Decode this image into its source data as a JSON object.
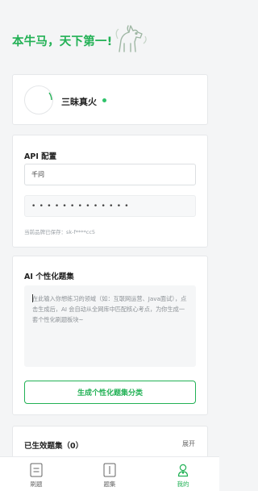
{
  "banner": {
    "slogan": "本牛马，天下第一!"
  },
  "profile": {
    "name": "三昧真火",
    "status_color": "#2fc26a"
  },
  "api_config": {
    "title": "API 配置",
    "model_value": "千问",
    "key_value": "•••••••••••••",
    "saved_hint": "当前品牌已保存：sk-f****cc5"
  },
  "ai_section": {
    "title": "AI 个性化题集",
    "placeholder": "在此输入你想练习的领域（如：互联网运营、Java面试），点击生成后，AI 会自动从全网库中匹配核心考点，为你生成一套个性化刷题板块~",
    "generate_label": "生成个性化题集分类"
  },
  "generated_section": {
    "title": "已生效题集（0）",
    "expand_label": "展开"
  },
  "tabbar": {
    "items": [
      {
        "label": "刷题",
        "icon": "question-list-icon"
      },
      {
        "label": "题集",
        "icon": "book-icon"
      },
      {
        "label": "我的",
        "icon": "user-icon"
      }
    ],
    "active_color": "#22b155"
  }
}
